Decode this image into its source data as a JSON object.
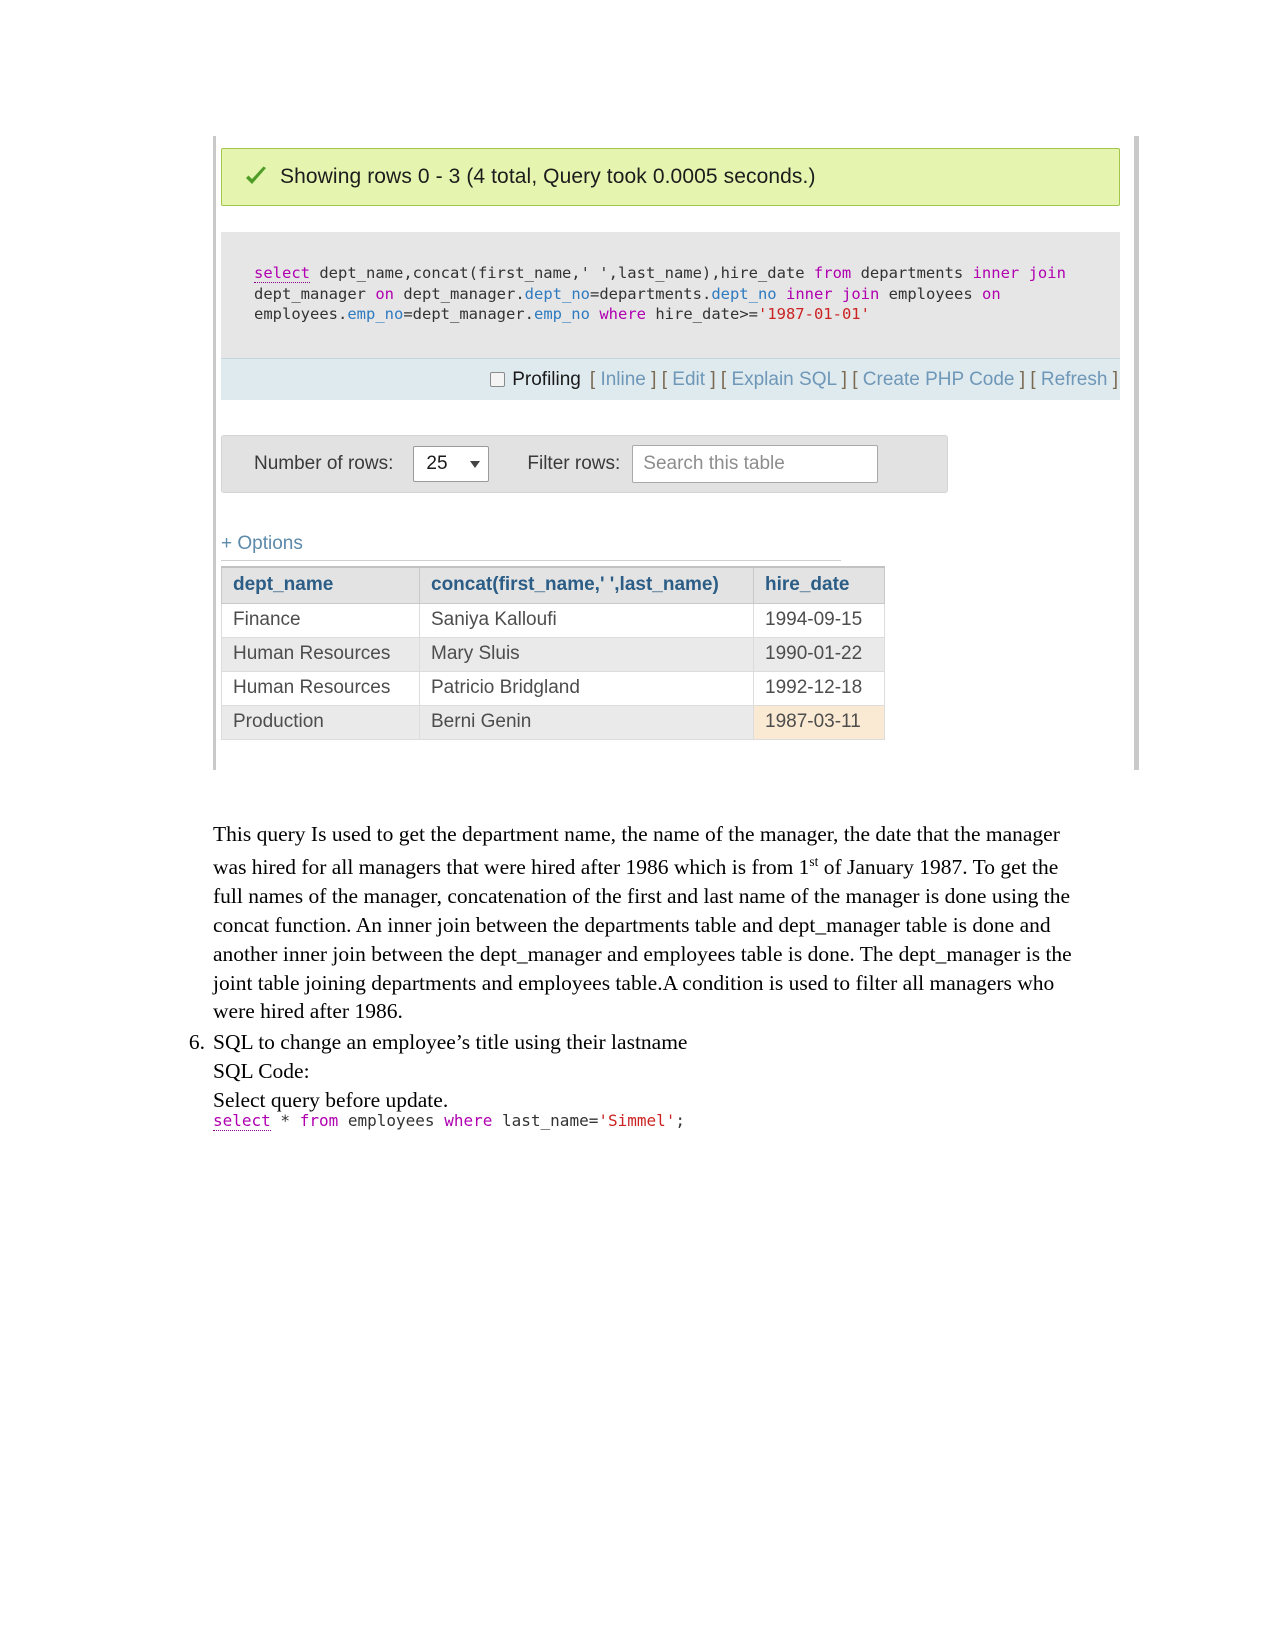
{
  "pma": {
    "banner": {
      "icon": "green-check-icon",
      "text": "Showing rows 0 - 3 (4 total, Query took 0.0005 seconds.)"
    },
    "sql": {
      "line1_kw_select": "select",
      "line1_a": " dept_name,concat(first_name,' ',last_name),hire_date ",
      "line1_kw_from": "from",
      "line1_b": " departments ",
      "line1_kw_inner": "inner",
      "line1_c": " ",
      "line1_kw_join": "join",
      "line2_a": "dept_manager ",
      "line2_kw_on": "on",
      "line2_b": " dept_manager.",
      "line2_col1": "dept_no",
      "line2_c": "=departments.",
      "line2_col2": "dept_no",
      "line2_d": " ",
      "line2_kw_inner": "inner",
      "line2_e": " ",
      "line2_kw_join": "join",
      "line2_f": " employees ",
      "line2_kw_on2": "on",
      "line3_a": "employees.",
      "line3_col1": "emp_no",
      "line3_b": "=dept_manager.",
      "line3_col2": "emp_no",
      "line3_c": " ",
      "line3_kw_where": "where",
      "line3_d": " hire_date>=",
      "line3_str": "'1987-01-01'",
      "full_text": "select dept_name,concat(first_name,' ',last_name),hire_date from departments inner join dept_manager on dept_manager.dept_no=departments.dept_no inner join employees on employees.emp_no=dept_manager.emp_no where hire_date>='1987-01-01'"
    },
    "actions": {
      "profiling_label": "Profiling",
      "open_bracket": "[",
      "close_bracket": "]",
      "inline": "Inline",
      "edit": "Edit",
      "explain_sql": "Explain SQL",
      "create_php_code": "Create PHP Code",
      "refresh": "Refresh"
    },
    "toolbar": {
      "rows_label": "Number of rows:",
      "rows_value": "25",
      "filter_label": "Filter rows:",
      "search_value": "",
      "search_placeholder": "Search this table"
    },
    "options_link": "+ Options",
    "results": {
      "columns": [
        "dept_name",
        "concat(first_name,' ',last_name)",
        "hire_date"
      ],
      "rows": [
        [
          "Finance",
          "Saniya Kalloufi",
          "1994-09-15"
        ],
        [
          "Human Resources",
          "Mary Sluis",
          "1990-01-22"
        ],
        [
          "Human Resources",
          "Patricio Bridgland",
          "1992-12-18"
        ],
        [
          "Production",
          "Berni Genin",
          "1987-03-11"
        ]
      ]
    }
  },
  "document": {
    "paragraph_1": "This query Is used to get the department name, the name of the manager, the date that the manager was hired for all managers that were hired after 1986 which is from 1",
    "paragraph_1_sup": "st",
    "paragraph_1_cont": " of January 1987. To get the full names of the manager, concatenation of the first and last name of the manager is done using the concat function. An inner join between the departments table and dept_manager table is done and another inner join between the dept_manager and employees table is done. The dept_manager is the joint table joining departments and employees table.A condition is used to filter all managers who were hired after 1986.",
    "item_number": "6.",
    "item_title": "SQL to change an employee’s title using their lastname",
    "item_line2": "SQL Code:",
    "item_line3": "Select query before update.",
    "code": {
      "kw_select": "select",
      "a": " * ",
      "kw_from": "from",
      "b": " employees ",
      "kw_where": "where",
      "c": " last_name=",
      "str": "'Simmel'",
      "d": ";",
      "full_text": "select * from employees where last_name='Simmel';"
    }
  },
  "colors": {
    "banner_bg": "#e5f5b0",
    "banner_border": "#a2c64b",
    "sql_bg": "#e6e6e6",
    "action_bar_bg": "#dfeaef",
    "link_blue": "#6e97b8",
    "keyword_magenta": "#b000b0",
    "column_blue": "#2d7ac0",
    "string_red": "#cc2222",
    "header_text": "#2b5d86",
    "highlight_cell": "#fbead3"
  }
}
